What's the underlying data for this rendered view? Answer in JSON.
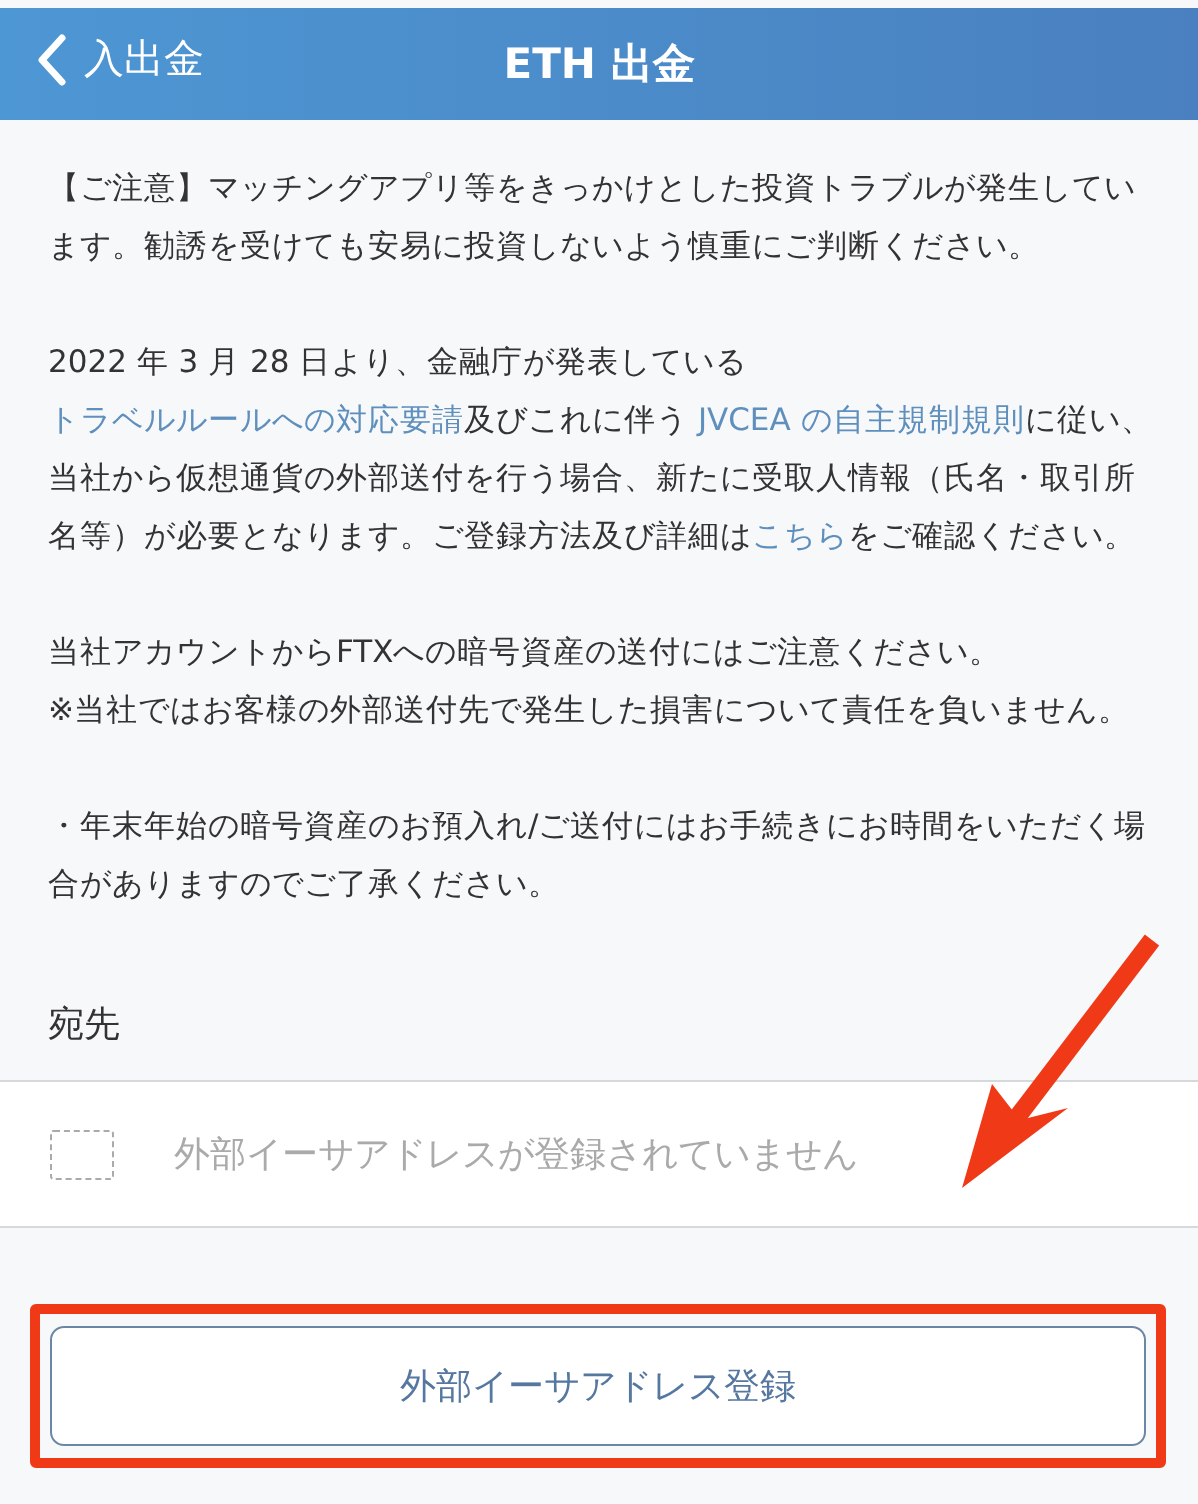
{
  "header": {
    "back_label": "入出金",
    "title": "ETH 出金"
  },
  "notices": [
    {
      "segments": [
        {
          "text": "【ご注意】マッチングアプリ等をきっかけとした投資トラブルが発生しています。勧誘を受けても安易に投資しないよう慎重にご判断ください。",
          "link": false
        }
      ]
    },
    {
      "segments": [
        {
          "text": "2022 年 3 月 28 日より、金融庁が発表している",
          "link": false
        },
        {
          "text": "トラベルルールへの対応要請",
          "link": true
        },
        {
          "text": "及びこれに伴う ",
          "link": false
        },
        {
          "text": "JVCEA の自主規制規則",
          "link": true
        },
        {
          "text": "に従い、当社から仮想通貨の外部送付を行う場合、新たに受取人情報（氏名・取引所名等）が必要となります。ご登録方法及び詳細は",
          "link": false
        },
        {
          "text": "こちら",
          "link": true
        },
        {
          "text": "をご確認ください。",
          "link": false
        }
      ]
    },
    {
      "segments": [
        {
          "text": "当社アカウントからFTXへの暗号資産の送付にはご注意ください。\n※当社ではお客様の外部送付先で発生した損害について責任を負いません。",
          "link": false
        }
      ]
    },
    {
      "segments": [
        {
          "text": "・年末年始の暗号資産のお預入れ/ご送付にはお手続きにお時間をいただく場合がありますのでご了承ください。",
          "link": false
        }
      ]
    }
  ],
  "destination": {
    "label": "宛先",
    "empty_text": "外部イーサアドレスが登録されていません"
  },
  "register_button": "外部イーサアドレス登録"
}
